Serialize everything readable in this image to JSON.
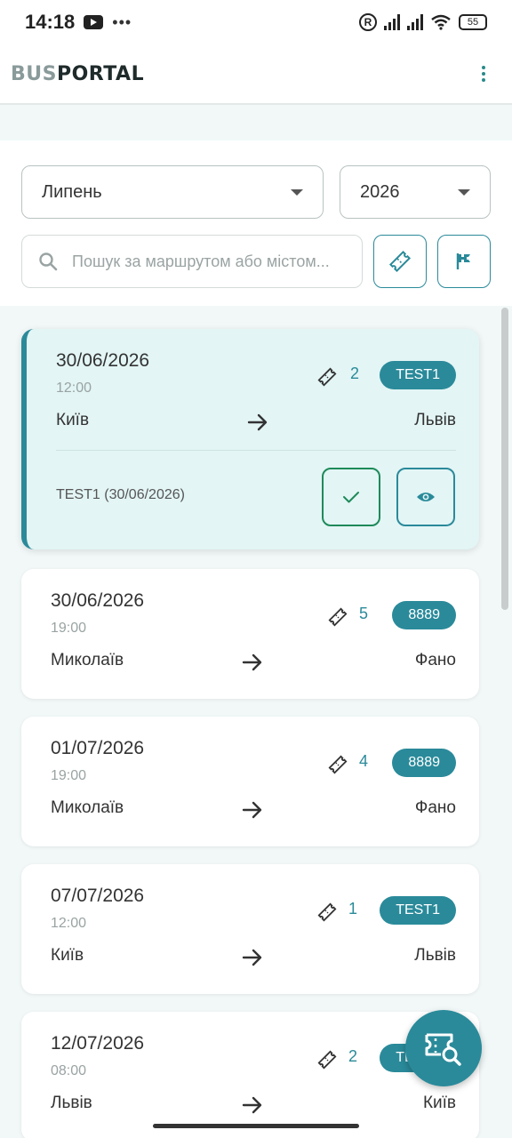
{
  "status_bar": {
    "time": "14:18",
    "dots": "•••",
    "r_label": "R",
    "battery": "55"
  },
  "header": {
    "logo_bus": "BUS",
    "logo_portal": "PORTAL"
  },
  "filters": {
    "month": "Липень",
    "year": "2026",
    "search_placeholder": "Пошук за маршрутом або містом..."
  },
  "trips": [
    {
      "date": "30/06/2026",
      "time": "12:00",
      "from": "Київ",
      "to": "Львів",
      "tickets": "2",
      "badge": "TEST1",
      "label": "TEST1 (30/06/2026)",
      "expanded": true
    },
    {
      "date": "30/06/2026",
      "time": "19:00",
      "from": "Миколаїв",
      "to": "Фано",
      "tickets": "5",
      "badge": "8889"
    },
    {
      "date": "01/07/2026",
      "time": "19:00",
      "from": "Миколаїв",
      "to": "Фано",
      "tickets": "4",
      "badge": "8889"
    },
    {
      "date": "07/07/2026",
      "time": "12:00",
      "from": "Київ",
      "to": "Львів",
      "tickets": "1",
      "badge": "TEST1"
    },
    {
      "date": "12/07/2026",
      "time": "08:00",
      "from": "Львів",
      "to": "Київ",
      "tickets": "2",
      "badge": "TEST1"
    }
  ],
  "colors": {
    "accent": "#2a8a9a",
    "active_card": "#e3f5f5",
    "confirm": "#1e8a5a"
  },
  "icons": [
    "youtube-icon",
    "search-icon",
    "ticket-icon",
    "flag-icon",
    "check-icon",
    "eye-icon",
    "arrow-right-icon",
    "ticket-search-icon",
    "kebab-icon"
  ]
}
